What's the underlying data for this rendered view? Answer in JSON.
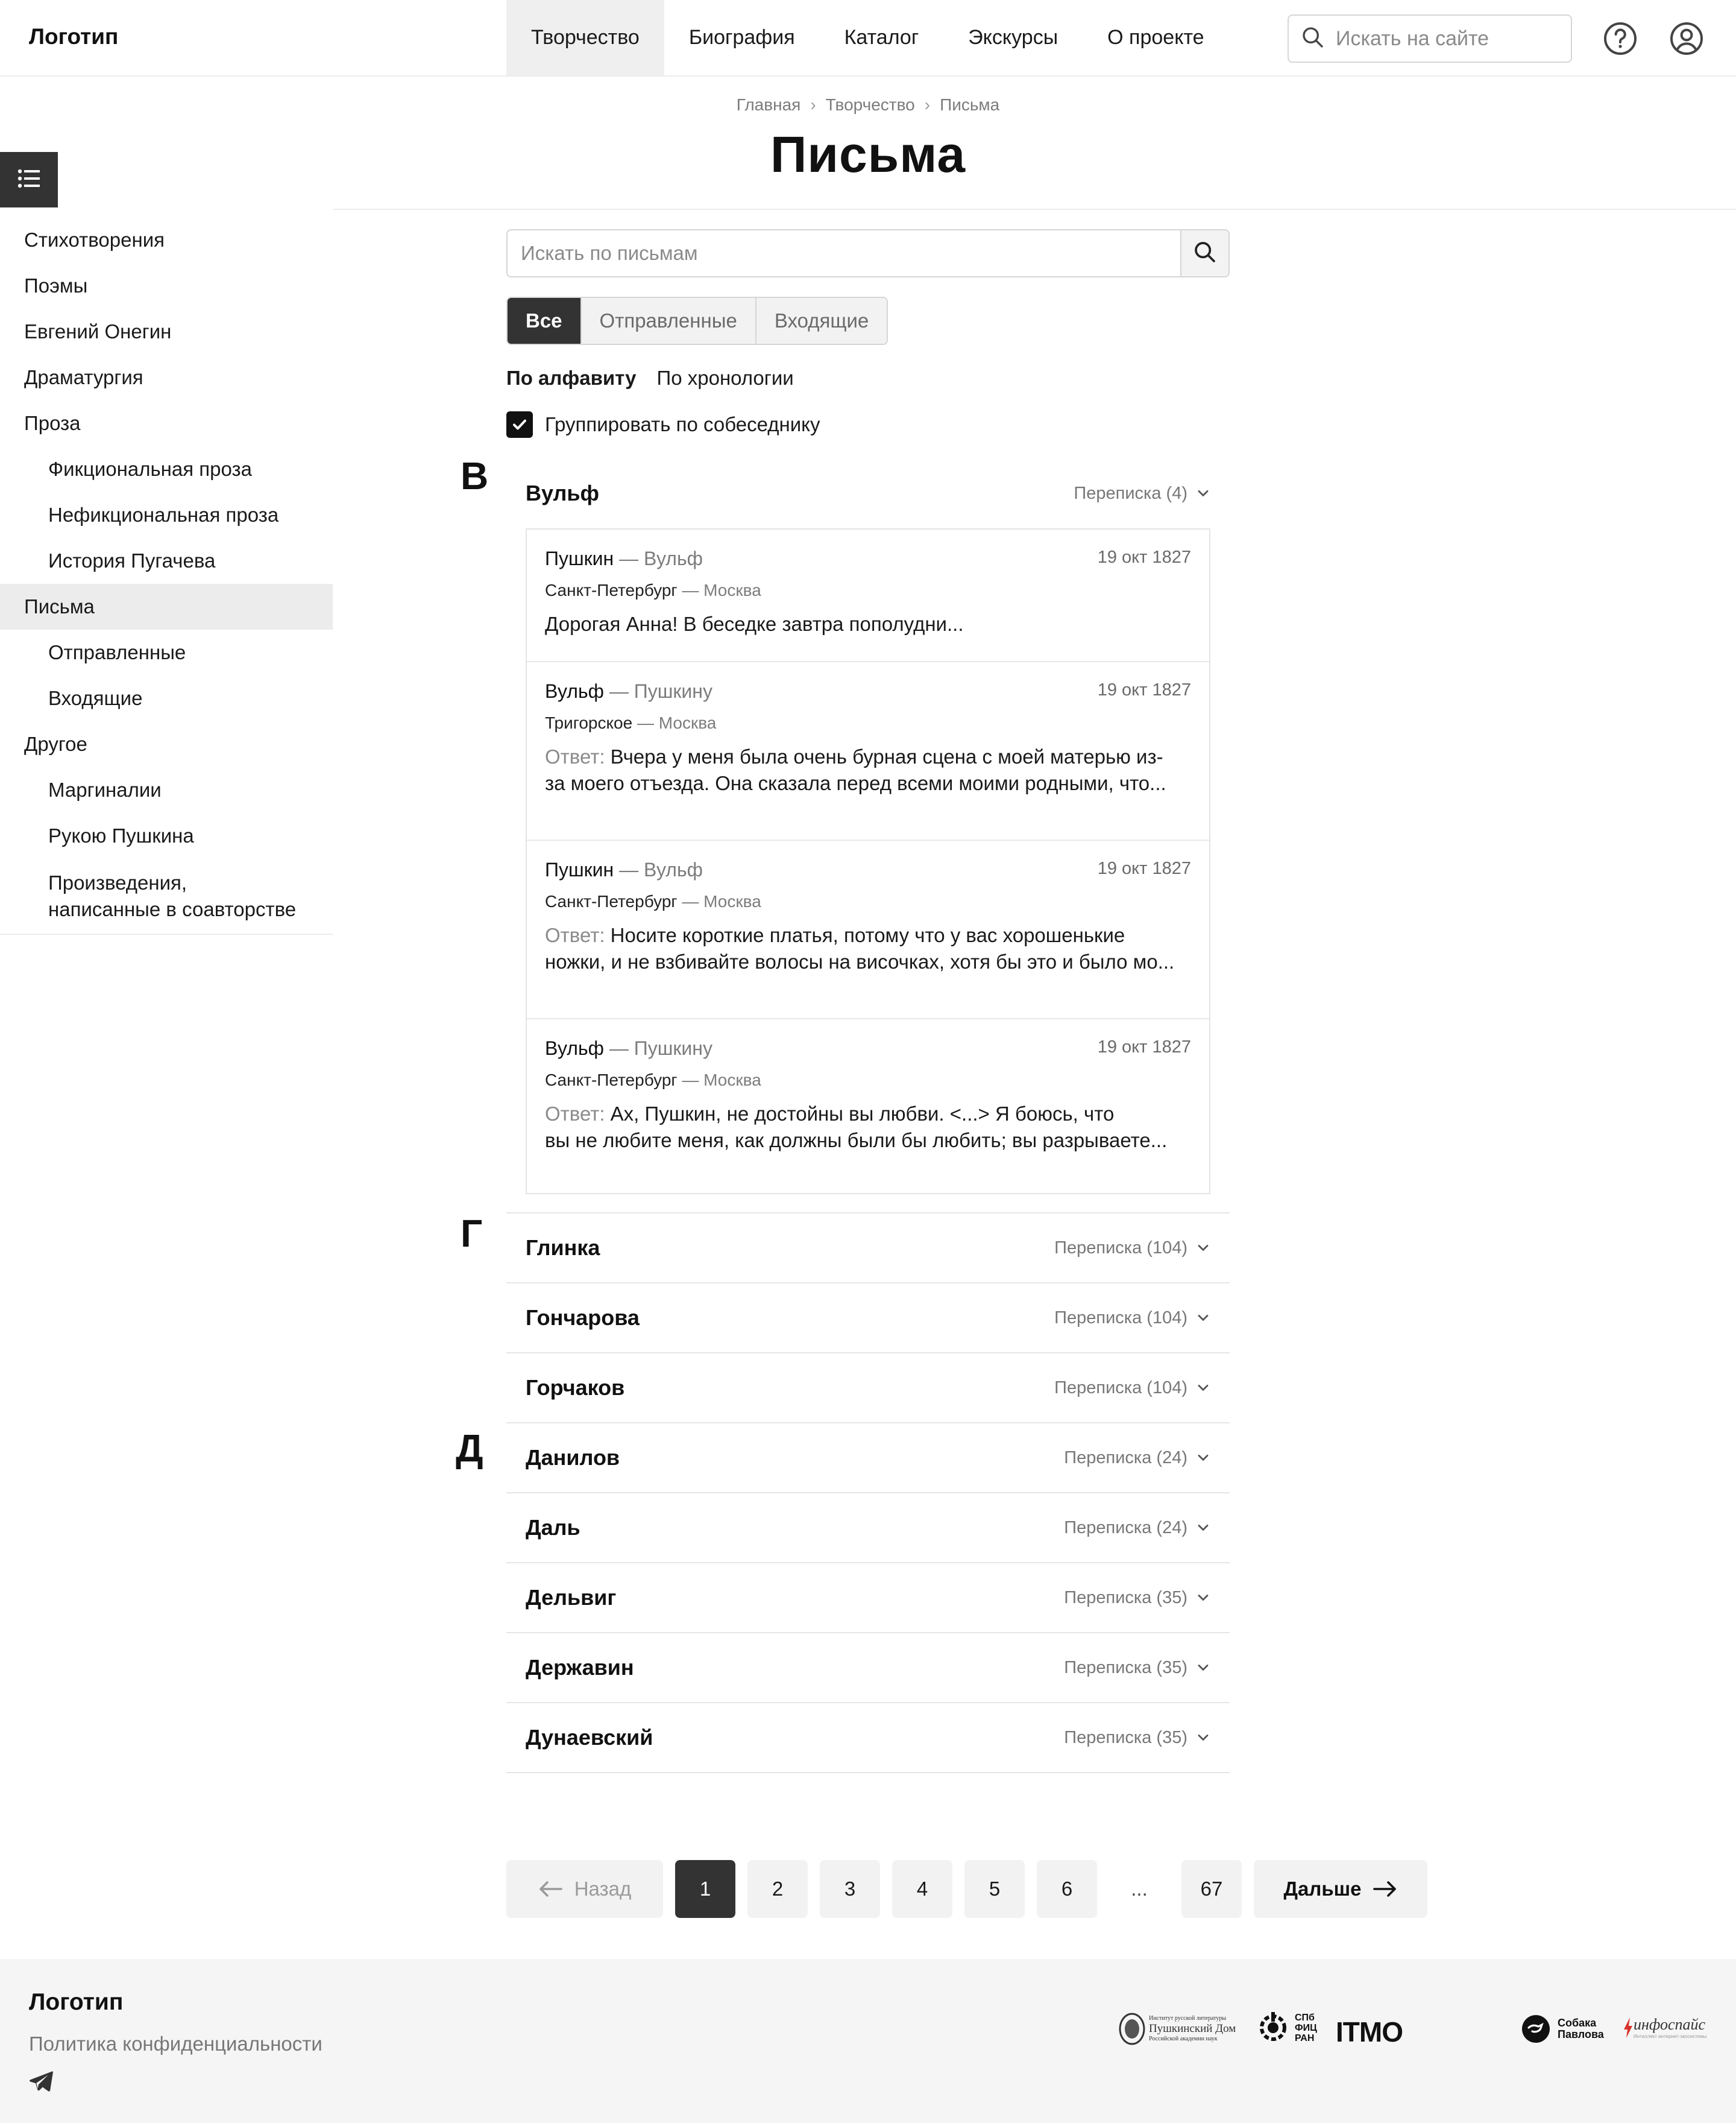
{
  "header": {
    "logo": "Логотип",
    "nav": [
      "Творчество",
      "Биография",
      "Каталог",
      "Экскурсы",
      "О проекте"
    ],
    "active_nav": "Творчество",
    "search_placeholder": "Искать на сайте",
    "icons": [
      "search-icon",
      "help-icon",
      "user-icon"
    ]
  },
  "breadcrumb": [
    "Главная",
    "Творчество",
    "Письма"
  ],
  "page_title": "Письма",
  "sidebar": {
    "toggle_icon": "list-icon",
    "items": [
      {
        "label": "Стихотворения",
        "level": 1
      },
      {
        "label": "Поэмы",
        "level": 1
      },
      {
        "label": "Евгений Онегин",
        "level": 1
      },
      {
        "label": "Драматургия",
        "level": 1
      },
      {
        "label": "Проза",
        "level": 1
      },
      {
        "label": "Фикциональная проза",
        "level": 2
      },
      {
        "label": "Нефикциональная проза",
        "level": 2
      },
      {
        "label": "История Пугачева",
        "level": 2
      },
      {
        "label": "Письма",
        "level": 1,
        "active": true
      },
      {
        "label": "Отправленные",
        "level": 2
      },
      {
        "label": "Входящие",
        "level": 2
      },
      {
        "label": "Другое",
        "level": 1
      },
      {
        "label": "Маргиналии",
        "level": 2
      },
      {
        "label": "Рукою Пушкина",
        "level": 2
      },
      {
        "label": "Произведения,",
        "label2": "написанные в соавторстве",
        "level": 2
      }
    ]
  },
  "letters_search": {
    "placeholder": "Искать по письмам"
  },
  "filters": {
    "tabs": [
      "Все",
      "Отправленные",
      "Входящие"
    ],
    "active": "Все"
  },
  "sort": {
    "options": [
      "По алфавиту",
      "По хронологии"
    ],
    "active": "По алфавиту"
  },
  "group_by": {
    "label": "Группировать по собеседнику",
    "checked": true
  },
  "letters_section": {
    "В": "В",
    "Г": "Г",
    "Д": "Д"
  },
  "correspondents": [
    {
      "name": "Вульф",
      "meta": "Переписка (4)",
      "letter": "В",
      "open": true
    },
    {
      "name": "Глинка",
      "meta": "Переписка (104)",
      "letter": "Г"
    },
    {
      "name": "Гончарова",
      "meta": "Переписка (104)",
      "letter": "Г"
    },
    {
      "name": "Горчаков",
      "meta": "Переписка (104)",
      "letter": "Г"
    },
    {
      "name": "Данилов",
      "meta": "Переписка (24)",
      "letter": "Д"
    },
    {
      "name": "Даль",
      "meta": "Переписка (24)",
      "letter": "Д"
    },
    {
      "name": "Дельвиг",
      "meta": "Переписка (35)",
      "letter": "Д"
    },
    {
      "name": "Державин",
      "meta": "Переписка (35)",
      "letter": "Д"
    },
    {
      "name": "Дунаевский",
      "meta": "Переписка (35)",
      "letter": "Д"
    }
  ],
  "letters": [
    {
      "from": "Пушкин",
      "dash": "—",
      "to": "Вульф",
      "date": "19 окт 1827",
      "place_from": "Санкт-Петербург",
      "place_to": "— Москва",
      "prefix": "",
      "line1": "Дорогая Анна! В беседке завтра пополудни...",
      "line2": ""
    },
    {
      "from": "Вульф",
      "dash": "—",
      "to": "Пушкину",
      "date": "19 окт 1827",
      "place_from": "Тригорское",
      "place_to": "— Москва",
      "prefix": "Ответ:",
      "line1": "Вчера у меня была очень бурная сцена с моей матерью из-",
      "line2": "за моего отъезда. Она сказала перед всеми моими родными, что..."
    },
    {
      "from": "Пушкин",
      "dash": "—",
      "to": "Вульф",
      "date": "19 окт 1827",
      "place_from": "Санкт-Петербург",
      "place_to": "— Москва",
      "prefix": "Ответ:",
      "line1": "Носите короткие платья, потому что у вас хорошенькие",
      "line2": "ножки, и не взбивайте волосы на височках, хотя бы это и было мо..."
    },
    {
      "from": "Вульф",
      "dash": "—",
      "to": "Пушкину",
      "date": "19 окт 1827",
      "place_from": "Санкт-Петербург",
      "place_to": "— Москва",
      "prefix": "Ответ:",
      "line1": "Ах, Пушкин, не достойны вы любви. <...> Я боюсь, что",
      "line2": "вы не любите меня, как должны были бы любить; вы разрываете..."
    }
  ],
  "pagination": {
    "prev": "Назад",
    "pages": [
      "1",
      "2",
      "3",
      "4",
      "5",
      "6"
    ],
    "dots": "...",
    "last": "67",
    "next": "Дальше",
    "current": "1"
  },
  "footer": {
    "logo": "Логотип",
    "policy": "Политика конфиденциальности",
    "partners": {
      "pushkin_house_line1": "Институт русской литературы",
      "pushkin_house_line2": "Пушкинский Дом",
      "pushkin_house_line3": "Российской академии наук",
      "spb_line1": "СПб",
      "spb_line2": "ФИЦ",
      "spb_line3": "РАН",
      "itmo": "ITMO",
      "sobaka_line1": "Собака",
      "sobaka_line2": "Павлова",
      "infospace": "инфоспайс",
      "infospace_sub": "Интеллект интернет-экосистемы"
    }
  },
  "colors": {
    "accent_dark": "#333333",
    "muted": "#7c7c7c",
    "active_bg": "#efefef"
  }
}
